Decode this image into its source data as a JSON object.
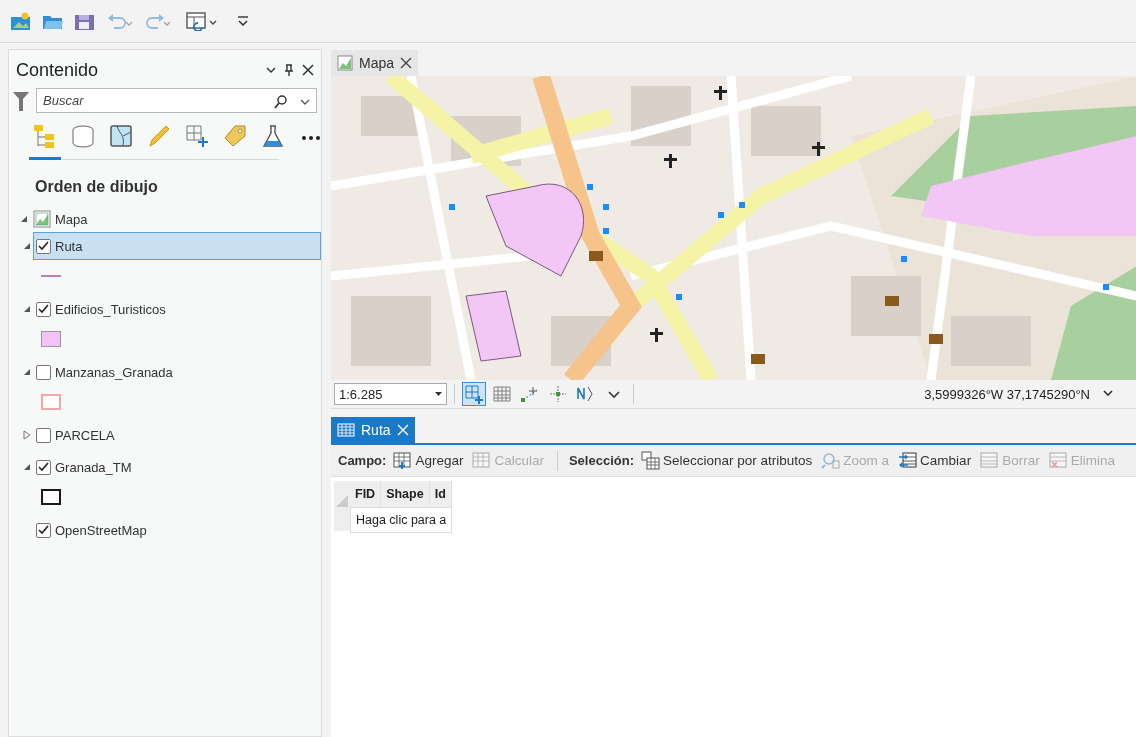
{
  "quick_access_toolbar": [
    {
      "kind": "new",
      "disabled": false
    },
    {
      "kind": "open",
      "disabled": false
    },
    {
      "kind": "save",
      "disabled": false
    },
    {
      "kind": "undo",
      "disabled": true
    },
    {
      "kind": "redo",
      "disabled": true
    },
    {
      "kind": "layout",
      "disabled": false
    },
    {
      "kind": "customize",
      "disabled": false
    }
  ],
  "contents_pane": {
    "title": "Contenido",
    "search": {
      "placeholder": "Buscar"
    },
    "tabs": [
      {
        "kind": "drawing-order",
        "selected": true
      },
      {
        "kind": "source",
        "selected": false
      },
      {
        "kind": "selection",
        "selected": false
      },
      {
        "kind": "editing",
        "selected": false
      },
      {
        "kind": "snapping",
        "selected": false
      },
      {
        "kind": "labeling",
        "selected": false
      },
      {
        "kind": "charts",
        "selected": false
      },
      {
        "kind": "more",
        "selected": false
      }
    ],
    "heading": "Orden de dibujo",
    "tree": [
      {
        "name": "Mapa",
        "expanded": true,
        "children": [
          {
            "name": "Ruta",
            "checked": true,
            "expanded": true,
            "selected": true,
            "symbol": {
              "kind": "line",
              "color": "#c07cc0"
            }
          },
          {
            "name": "Edificios_Turisticos",
            "checked": true,
            "expanded": true,
            "selected": false,
            "symbol": {
              "kind": "fill",
              "color": "#f3c2f7"
            }
          },
          {
            "name": "Manzanas_Granada",
            "checked": false,
            "expanded": true,
            "selected": false,
            "symbol": {
              "kind": "outline",
              "color": "#f4a6a6"
            }
          },
          {
            "name": "PARCELA",
            "checked": false,
            "expanded": false,
            "selected": false
          },
          {
            "name": "Granada_TM",
            "checked": true,
            "expanded": true,
            "selected": false,
            "symbol": {
              "kind": "outline",
              "color": "#1a1a1a"
            }
          },
          {
            "name": "OpenStreetMap",
            "checked": true,
            "selected": false
          }
        ]
      }
    ]
  },
  "map_view": {
    "tab": {
      "title": "Mapa",
      "selected": true
    },
    "scale": "1:6.285",
    "tools": [
      {
        "kind": "grid-add",
        "selected": true
      },
      {
        "kind": "grid",
        "selected": false
      },
      {
        "kind": "snap",
        "selected": false
      },
      {
        "kind": "axis",
        "selected": false
      },
      {
        "kind": "north",
        "selected": false
      },
      {
        "kind": "dropdown",
        "selected": false
      }
    ],
    "coordinates": "3,5999326°W 37,1745290°N"
  },
  "table_view": {
    "tab": {
      "title": "Ruta",
      "selected": true
    },
    "toolbar": [
      {
        "kind": "label",
        "text": "Campo:"
      },
      {
        "kind": "add",
        "text": "Agregar",
        "disabled": false
      },
      {
        "kind": "calculate",
        "text": "Calcular",
        "disabled": true
      },
      {
        "kind": "separator"
      },
      {
        "kind": "label",
        "text": "Selección:"
      },
      {
        "kind": "select",
        "text": "Seleccionar por atributos",
        "disabled": false
      },
      {
        "kind": "zoom",
        "text": "Zoom a",
        "disabled": true
      },
      {
        "kind": "switch",
        "text": "Cambiar",
        "disabled": false
      },
      {
        "kind": "clear",
        "text": "Borrar",
        "disabled": true
      },
      {
        "kind": "delete",
        "text": "Elimina",
        "disabled": true
      }
    ],
    "columns": [
      "FID",
      "Shape",
      "Id"
    ],
    "new_row_hint": "Haga clic para a"
  }
}
